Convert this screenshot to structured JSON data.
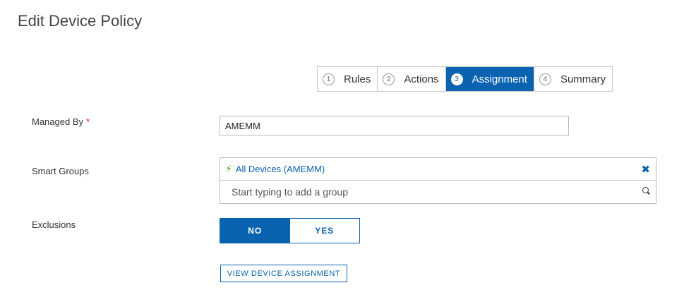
{
  "page": {
    "title": "Edit Device Policy"
  },
  "wizard": {
    "steps": [
      {
        "num": "1",
        "label": "Rules"
      },
      {
        "num": "2",
        "label": "Actions"
      },
      {
        "num": "3",
        "label": "Assignment"
      },
      {
        "num": "4",
        "label": "Summary"
      }
    ],
    "active_step": "Assignment"
  },
  "form": {
    "managed_by": {
      "label": "Managed By",
      "required_mark": "*",
      "value": "AMEMM"
    },
    "smart_groups": {
      "label": "Smart Groups",
      "selected": [
        {
          "name": "All Devices (AMEMM)",
          "icon": "magic-wand-icon"
        }
      ],
      "remove_glyph": "✖",
      "search_placeholder": "Start typing to add a group"
    },
    "exclusions": {
      "label": "Exclusions",
      "options": [
        "NO",
        "YES"
      ],
      "selected": "NO"
    },
    "view_assignment_button": "VIEW DEVICE ASSIGNMENT"
  },
  "colors": {
    "accent": "#0a63b0",
    "required": "#d9251c",
    "wand": "#4aa62e"
  }
}
